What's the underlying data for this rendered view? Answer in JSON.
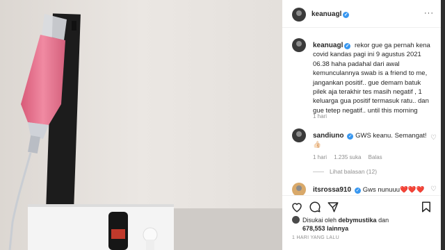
{
  "post": {
    "username": "keanuagl",
    "verified_mark": "✓",
    "more_icon": "···"
  },
  "caption": {
    "username": "keanuagl",
    "text": "rekor gue ga pernah kena covid kandas pagi ini 9 agustus 2021 06.38 haha padahal dari awal kemunculannya swab is a friend to me, jangankan positif.. gue demam batuk pilek aja terakhir tes masih negatif , 1 keluarga gua positif termasuk ratu.. dan gue tetep negatif.. until this morning",
    "time": "1 hari"
  },
  "comments": [
    {
      "username": "sandiuno",
      "text": "GWS keanu. Semangat! 👍🏻",
      "time": "1 hari",
      "likes": "1.235 suka",
      "reply": "Balas",
      "view_replies": "Lihat balasan (12)"
    },
    {
      "username": "itsrossa910",
      "text": "Gws nunuuu❤️❤️❤️"
    }
  ],
  "actions": {
    "liked_by_prefix": "Disukai oleh",
    "liked_by_user": "debymustika",
    "and": "dan",
    "others_count": "678,553",
    "others_label": "lainnya",
    "timestamp": "1 HARI YANG LALU"
  },
  "colors": {
    "verified": "#3897f0",
    "iv_fluid": "#e8708a",
    "text": "#262626",
    "muted": "#8e8e8e"
  }
}
